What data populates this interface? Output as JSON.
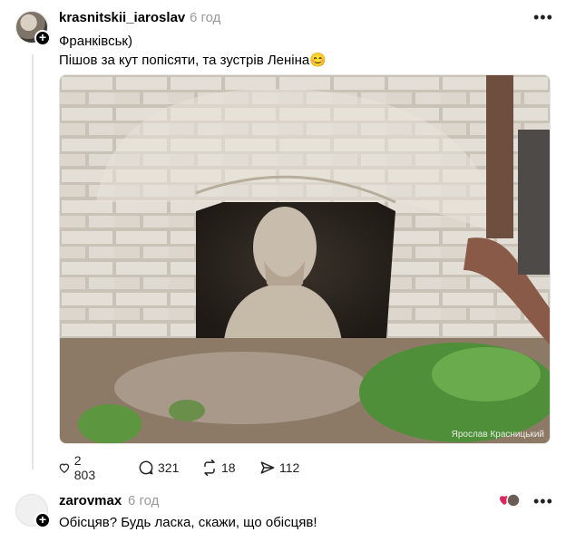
{
  "post": {
    "username": "krasnitskii_iaroslav",
    "time": "6 год",
    "lines": [
      "Франківськ)",
      "Пішов за кут попісяти, та зустрів Леніна😊"
    ],
    "photo_watermark": "Ярослав Красницький",
    "stats": {
      "likes": "2 803",
      "replies": "321",
      "reposts": "18",
      "shares": "112"
    }
  },
  "reply": {
    "username": "zarovmax",
    "time": "6 год",
    "text": "Обісцяв? Будь ласка, скажи, що обісцяв!"
  },
  "icons": {
    "more": "more-dots-icon",
    "like": "heart-icon",
    "reply": "comment-bubble-icon",
    "repost": "repost-arrows-icon",
    "share": "send-icon",
    "follow": "plus-icon"
  }
}
